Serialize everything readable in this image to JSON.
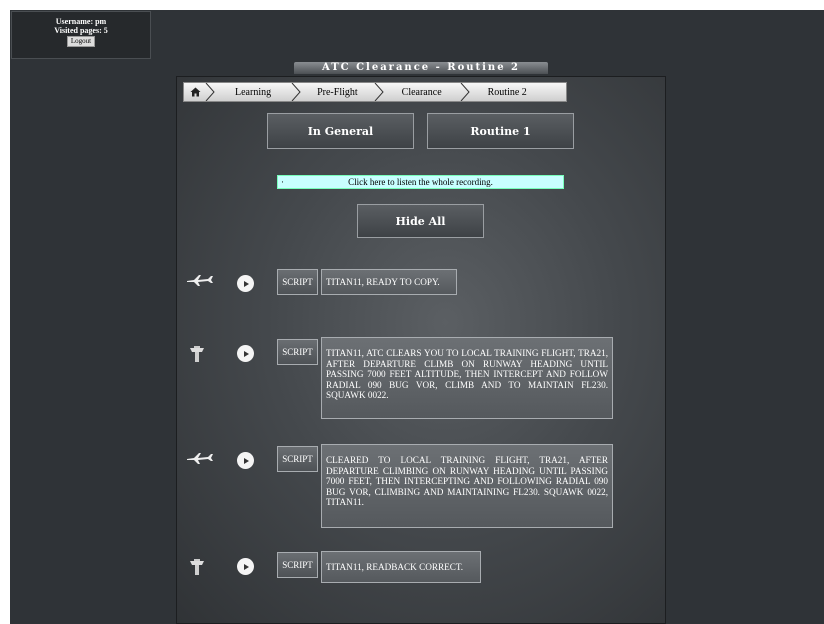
{
  "user": {
    "username_line": "Username: pm",
    "visited_line": "Visited pages: 5",
    "logout_label": "Logout"
  },
  "page": {
    "title": "ATC Clearance - Routine 2"
  },
  "breadcrumb": {
    "home_icon": "home-icon",
    "items": [
      "Learning",
      "Pre-Flight",
      "Clearance",
      "Routine 2"
    ]
  },
  "nav": {
    "in_general_label": "In General",
    "routine_label": "Routine 1",
    "listen_label": "Click here to listen the whole recording.",
    "listen_marker": "·",
    "hide_all_label": "Hide All"
  },
  "dialogue": [
    {
      "speaker": "pilot",
      "speaker_icon": "airplane-icon",
      "play_icon": "play-icon",
      "script_label": "SCRIPT",
      "text": "TITAN11, READY TO COPY."
    },
    {
      "speaker": "atc",
      "speaker_icon": "control-tower-icon",
      "play_icon": "play-icon",
      "script_label": "SCRIPT",
      "text": "TITAN11, ATC CLEARS YOU TO LOCAL TRAINING FLIGHT, TRA21, AFTER DEPARTURE CLIMB ON RUNWAY HEADING UNTIL PASSING 7000 FEET ALTITUDE, THEN INTERCEPT AND FOLLOW RADIAL 090 BUG VOR, CLIMB AND TO MAINTAIN FL230. SQUAWK 0022."
    },
    {
      "speaker": "pilot",
      "speaker_icon": "airplane-icon",
      "play_icon": "play-icon",
      "script_label": "SCRIPT",
      "text": "CLEARED TO LOCAL TRAINING FLIGHT, TRA21, AFTER DEPARTURE CLIMBING ON RUNWAY HEADING UNTIL PASSING 7000 FEET, THEN INTERCEPTING AND FOLLOWING RADIAL 090 BUG VOR, CLIMBING AND MAINTAINING FL230. SQUAWK 0022, TITAN11."
    },
    {
      "speaker": "atc",
      "speaker_icon": "control-tower-icon",
      "play_icon": "play-icon",
      "script_label": "SCRIPT",
      "text": "TITAN11, READBACK CORRECT."
    }
  ]
}
